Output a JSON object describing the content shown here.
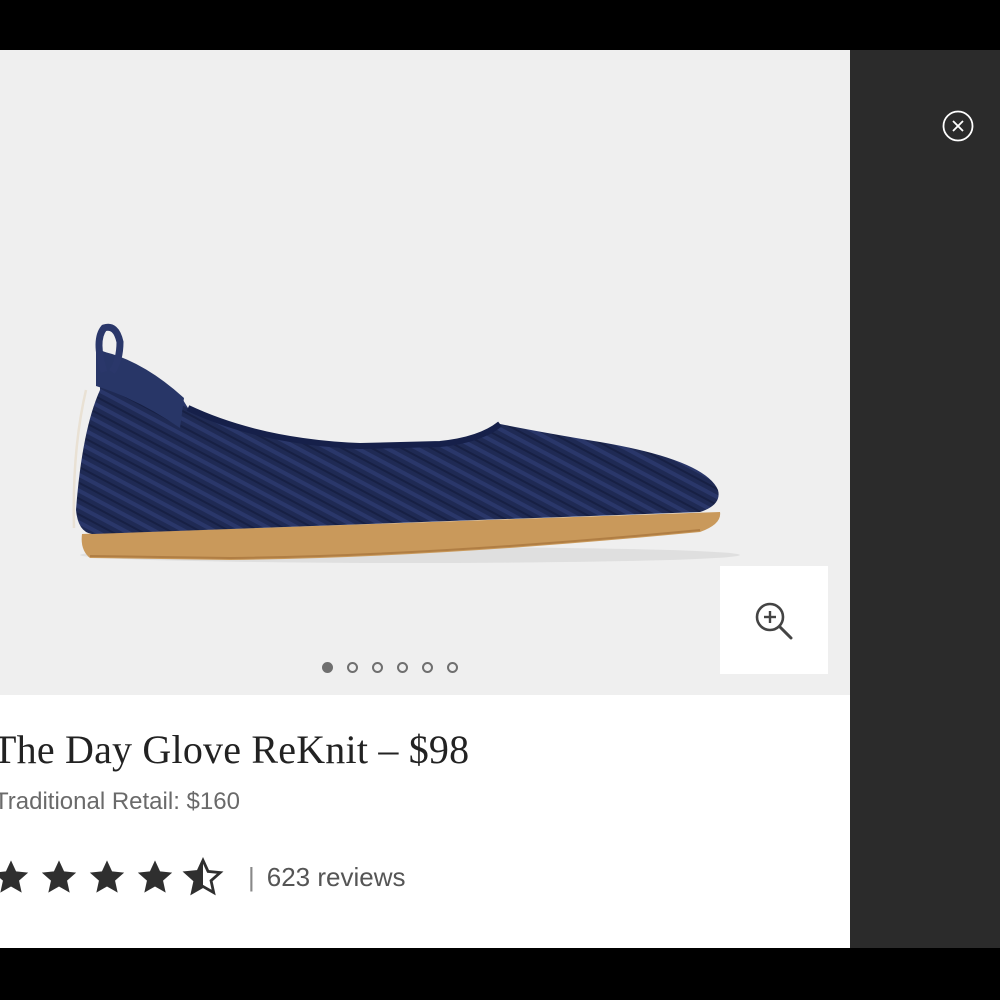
{
  "product": {
    "title": "The Day Glove ReKnit – $98",
    "traditional_retail": "Traditional Retail: $160",
    "rating": 4.5,
    "rating_max": 5,
    "rating_separator": "|",
    "reviews_label": "623 reviews",
    "image_alt": "navy knit ballet flat",
    "colors": {
      "knit": "#1f2a54",
      "sole": "#c9995b",
      "text": "#222222"
    }
  },
  "gallery": {
    "slide_count": 6,
    "active_slide": 1
  },
  "icons": {
    "close": "close-icon",
    "zoom": "zoom-in-icon",
    "star": "star-icon"
  }
}
